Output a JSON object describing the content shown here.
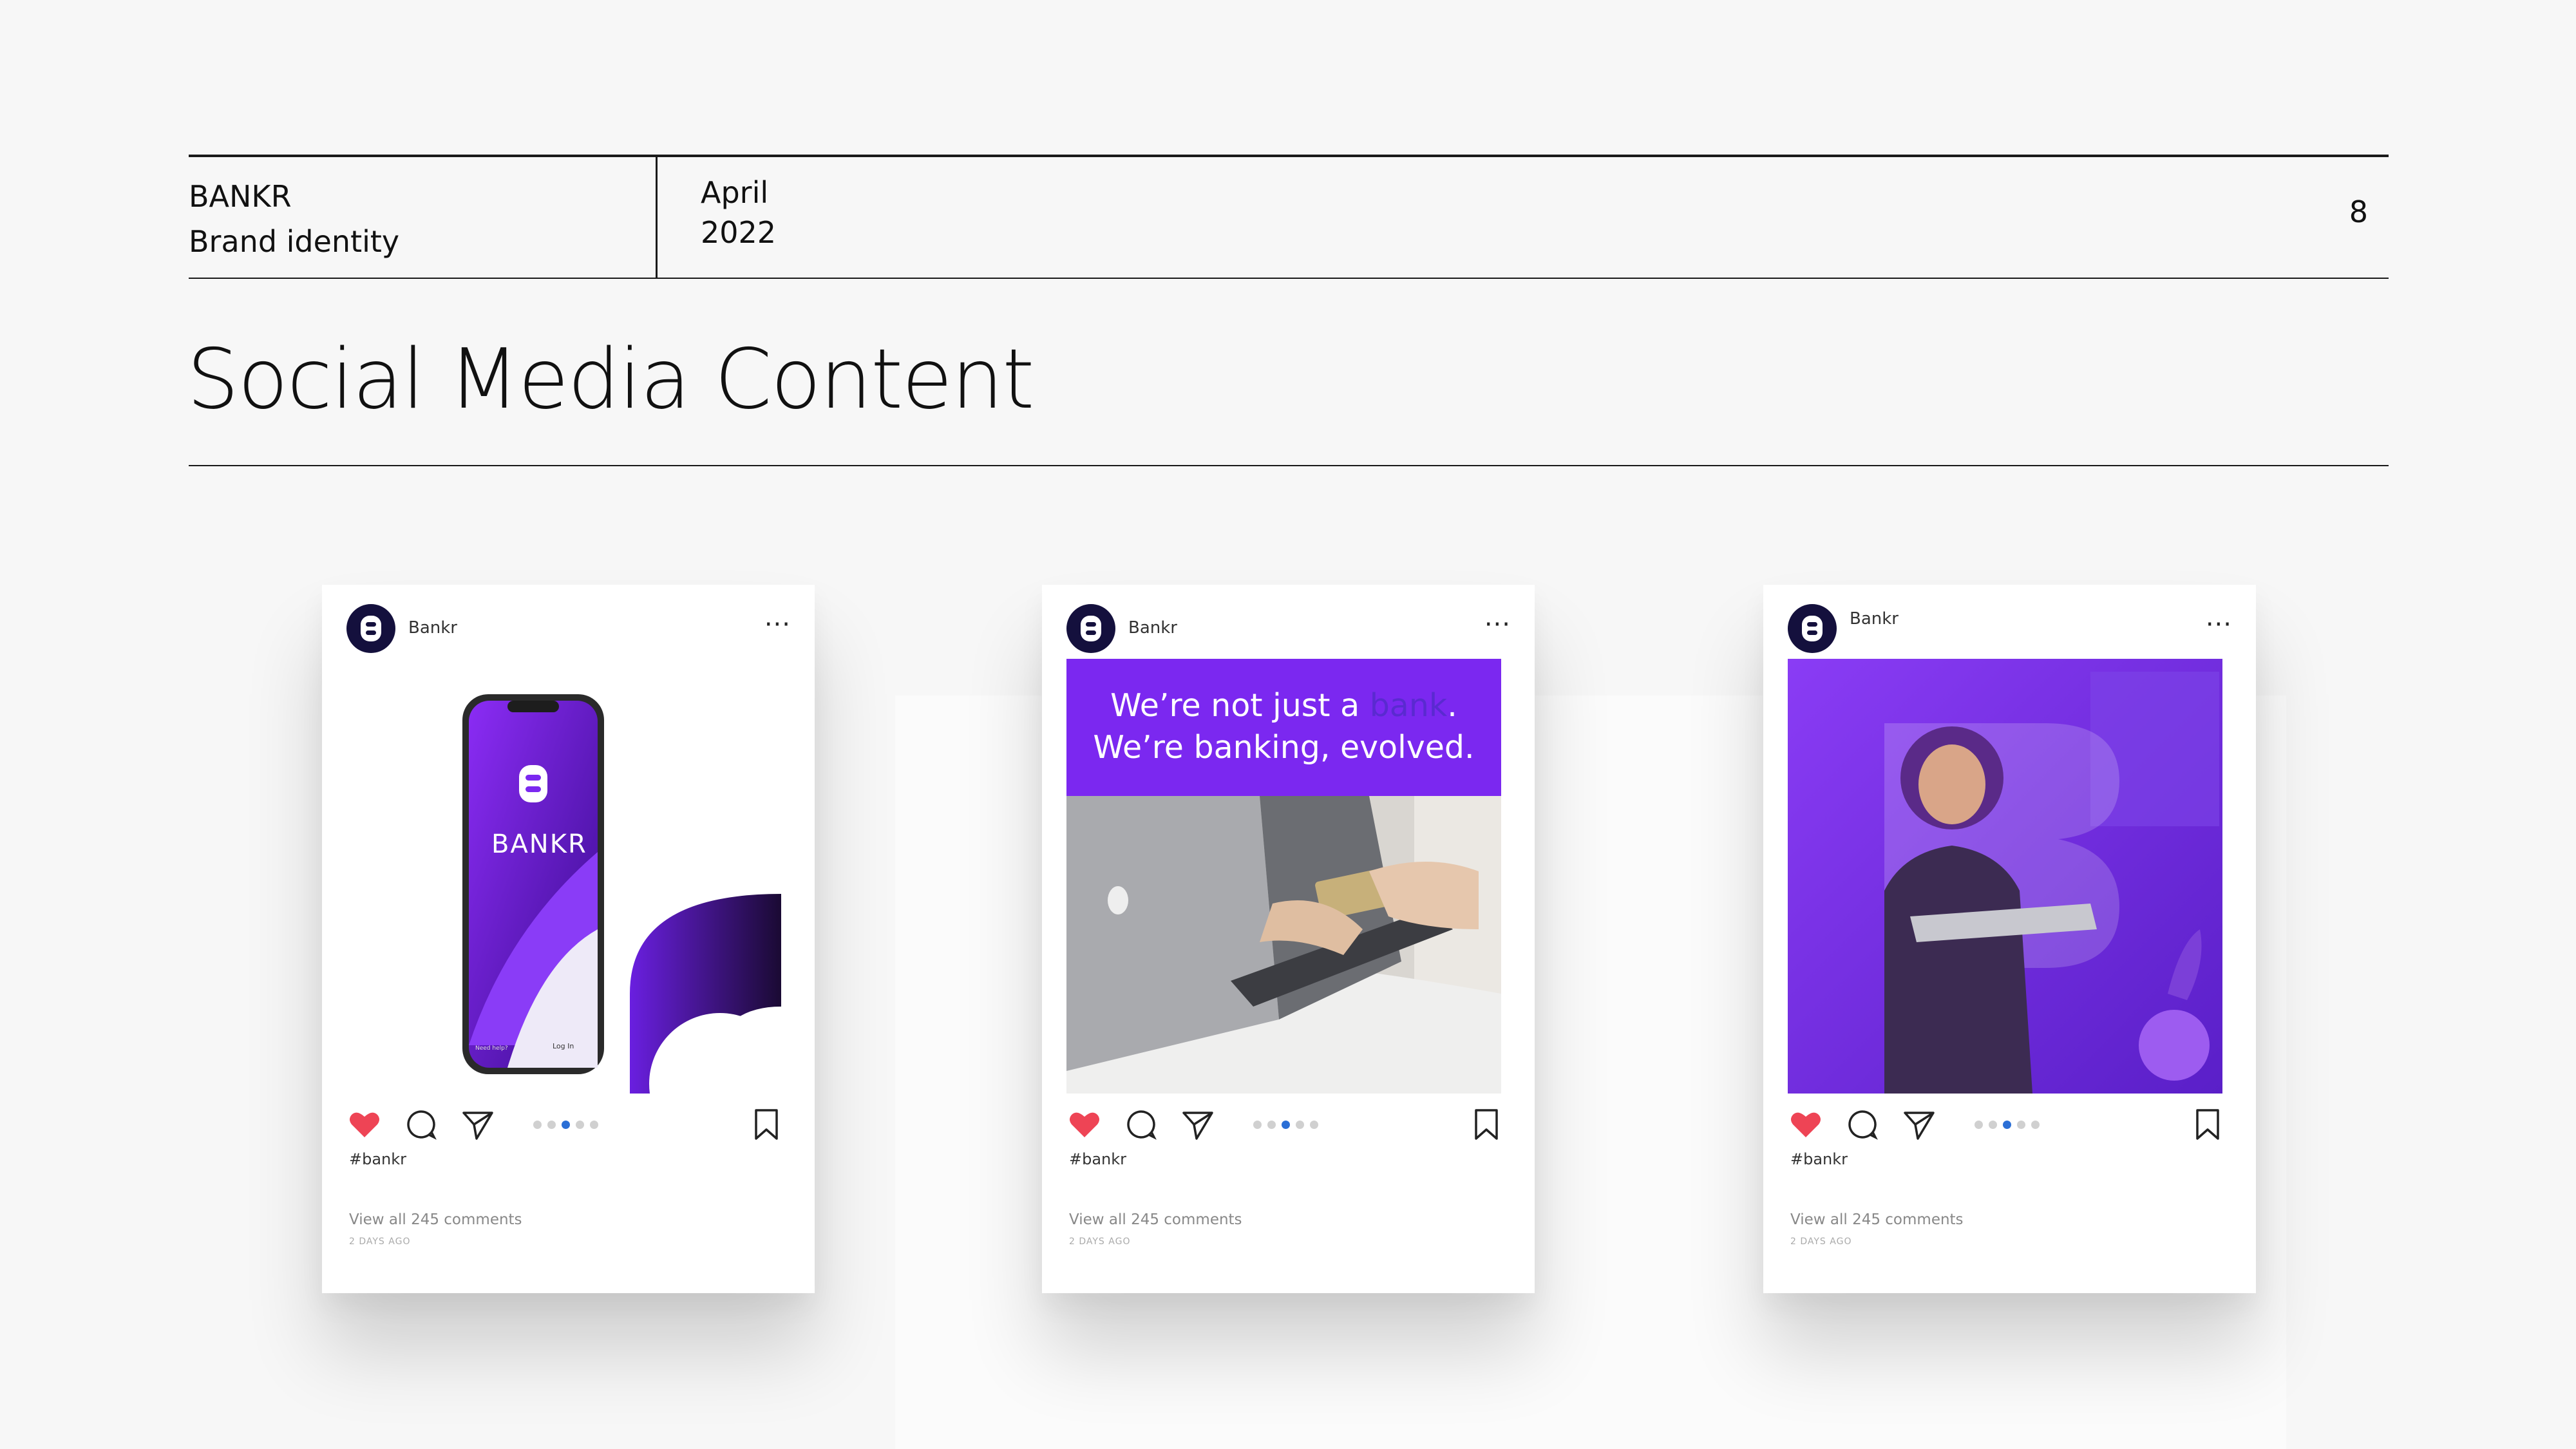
{
  "header": {
    "brand_name": "BANKR",
    "brand_subtitle": "Brand identity",
    "month": "April",
    "year": "2022",
    "page_number": "8"
  },
  "title": "Social Media Content",
  "posts": [
    {
      "username": "Bankr",
      "hashtag": "#bankr",
      "comments": "View all 245 comments",
      "time_ago": "2 DAYS AGO",
      "media": {
        "phone_wordmark": "BANKR",
        "phone_login": "Log In",
        "phone_help": "Need help?"
      }
    },
    {
      "username": "Bankr",
      "hashtag": "#bankr",
      "comments": "View all 245 comments",
      "time_ago": "2 DAYS AGO",
      "media": {
        "banner_part1": "We’re not just a ",
        "banner_highlight": "bank",
        "banner_part2": ". We’re banking, evolved."
      }
    },
    {
      "username": "Bankr",
      "hashtag": "#bankr",
      "comments": "View all 245 comments",
      "time_ago": "2 DAYS AGO",
      "media": {}
    }
  ],
  "colors": {
    "brand_purple": "#7b28f0",
    "brand_navy": "#14103d",
    "like_red": "#ee4455"
  },
  "icons": [
    "heart-icon",
    "comment-icon",
    "share-icon",
    "bookmark-icon",
    "more-icon"
  ],
  "carousel": {
    "total": 5,
    "active": 3
  }
}
